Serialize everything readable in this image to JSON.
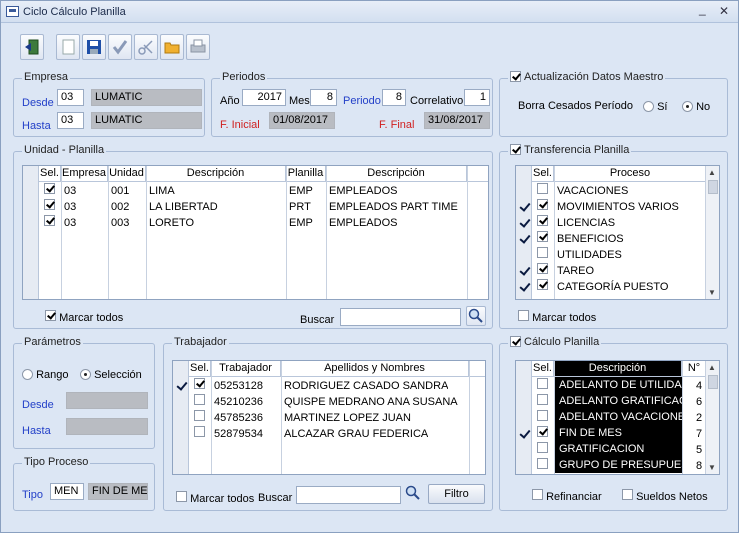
{
  "window": {
    "title": "Ciclo Cálculo Planilla",
    "min": "_",
    "close": "✕"
  },
  "empresa": {
    "title": "Empresa",
    "desde_label": "Desde",
    "desde_code": "03",
    "desde_name": "LUMATIC",
    "hasta_label": "Hasta",
    "hasta_code": "03",
    "hasta_name": "LUMATIC"
  },
  "periodos": {
    "title": "Periodos",
    "anio_label": "Año",
    "anio": "2017",
    "mes_label": "Mes",
    "mes": "8",
    "periodo_label": "Periodo",
    "periodo": "8",
    "correlativo_label": "Correlativo",
    "correlativo": "1",
    "finicial_label": "F. Inicial",
    "finicial": "01/08/2017",
    "ffinal_label": "F. Final",
    "ffinal": "31/08/2017"
  },
  "actualizacion": {
    "title": "Actualización Datos Maestro",
    "borra_label": "Borra Cesados Período",
    "si": "Sí",
    "no": "No"
  },
  "unidad": {
    "title": "Unidad - Planilla",
    "headers": [
      "Sel.",
      "Empresa",
      "Unidad",
      "Descripción",
      "Planilla",
      "Descripción"
    ],
    "rows": [
      {
        "empresa": "03",
        "unidad": "001",
        "desc": "LIMA",
        "planilla": "EMP",
        "desc2": "EMPLEADOS"
      },
      {
        "empresa": "03",
        "unidad": "002",
        "desc": "LA LIBERTAD",
        "planilla": "PRT",
        "desc2": "EMPLEADOS  PART TIME"
      },
      {
        "empresa": "03",
        "unidad": "003",
        "desc": "LORETO",
        "planilla": "EMP",
        "desc2": "EMPLEADOS"
      }
    ],
    "marcar": "Marcar todos",
    "buscar": "Buscar"
  },
  "transferencia": {
    "title": "Transferencia Planilla",
    "headers": [
      "Sel.",
      "Proceso"
    ],
    "rows": [
      "VACACIONES",
      "MOVIMIENTOS VARIOS",
      "LICENCIAS",
      "BENEFICIOS",
      "UTILIDADES",
      "TAREO",
      "CATEGORÍA PUESTO"
    ],
    "marcar": "Marcar todos"
  },
  "parametros": {
    "title": "Parámetros",
    "rango": "Rango",
    "seleccion": "Selección",
    "desde": "Desde",
    "hasta": "Hasta"
  },
  "tipo": {
    "title": "Tipo Proceso",
    "label": "Tipo",
    "code": "MEN",
    "name": "FIN DE MES"
  },
  "trabajador": {
    "title": "Trabajador",
    "headers": [
      "Sel.",
      "Trabajador",
      "Apellidos y Nombres"
    ],
    "rows": [
      {
        "id": "05253128",
        "name": "RODRIGUEZ CASADO SANDRA"
      },
      {
        "id": "45210236",
        "name": "QUISPE MEDRANO ANA SUSANA"
      },
      {
        "id": "45785236",
        "name": "MARTINEZ LOPEZ JUAN"
      },
      {
        "id": "52879534",
        "name": "ALCAZAR GRAU FEDERICA"
      }
    ],
    "marcar": "Marcar todos",
    "buscar": "Buscar",
    "filtro": "Filtro"
  },
  "calculo": {
    "title": "Cálculo Planilla",
    "headers": [
      "Sel.",
      "Descripción",
      "N°"
    ],
    "rows": [
      {
        "desc": "ADELANTO DE UTILIDADES",
        "n": "4"
      },
      {
        "desc": "ADELANTO GRATIFICACION",
        "n": "6"
      },
      {
        "desc": "ADELANTO VACACIONES",
        "n": "2"
      },
      {
        "desc": "FIN DE MES",
        "n": "7"
      },
      {
        "desc": "GRATIFICACION",
        "n": "5"
      },
      {
        "desc": "GRUPO DE PRESUPUESTO",
        "n": "8"
      }
    ],
    "refinanciar": "Refinanciar",
    "sueldos": "Sueldos Netos"
  }
}
